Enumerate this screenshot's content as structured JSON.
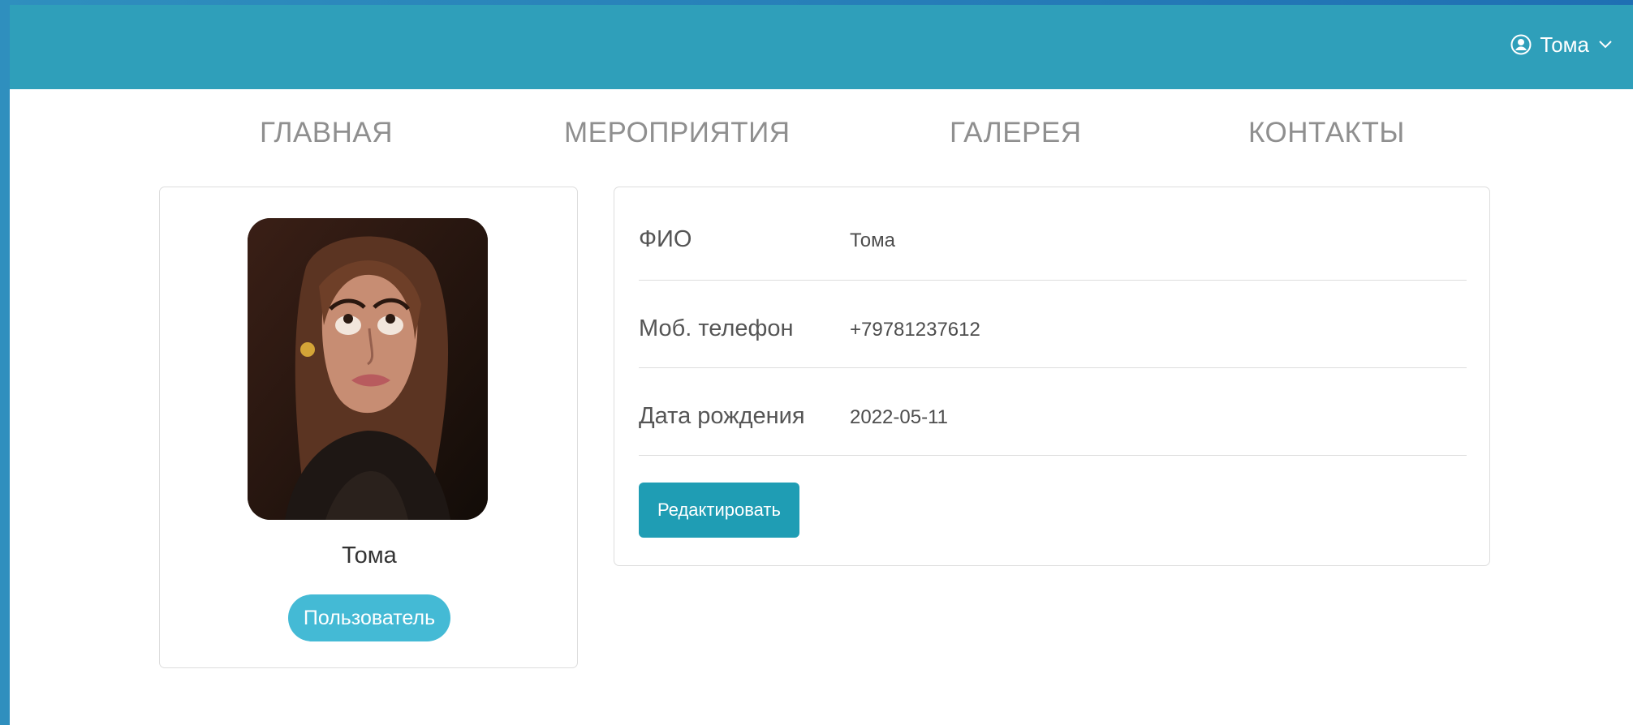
{
  "topbar": {
    "user": {
      "name": "Тома"
    }
  },
  "nav": {
    "items": [
      {
        "label": "ГЛАВНАЯ"
      },
      {
        "label": "МЕРОПРИЯТИЯ"
      },
      {
        "label": "ГАЛЕРЕЯ"
      },
      {
        "label": "КОНТАКТЫ"
      }
    ]
  },
  "profile": {
    "name": "Тома",
    "role": "Пользователь"
  },
  "details": {
    "rows": [
      {
        "label": "ФИО",
        "value": "Тома"
      },
      {
        "label": "Моб. телефон",
        "value": "+79781237612"
      },
      {
        "label": "Дата рождения",
        "value": "2022-05-11"
      }
    ],
    "edit_label": "Редактировать"
  },
  "colors": {
    "header": "#2f9fba",
    "button": "#1f9db4",
    "badge": "#44bad5"
  }
}
